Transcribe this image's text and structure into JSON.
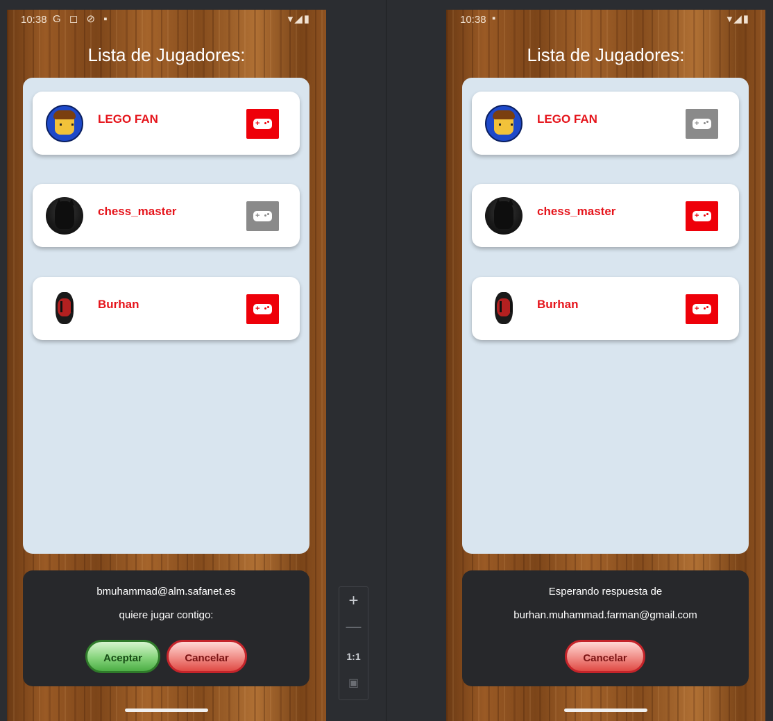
{
  "left": {
    "status_time": "10:38",
    "status_icons": "G ◻ ⊘ ▪",
    "signal_icons": "▾◢▮",
    "title": "Lista de Jugadores:",
    "players": [
      {
        "name": "LEGO FAN",
        "avatar": "lego-avatar",
        "game_button": "active"
      },
      {
        "name": "chess_master",
        "avatar": "batman-avatar",
        "game_button": "disabled"
      },
      {
        "name": "Burhan",
        "avatar": "darth-maul-avatar",
        "game_button": "active"
      }
    ],
    "dialog": {
      "line1": "bmuhammad@alm.safanet.es",
      "line2": "quiere jugar contigo:",
      "accept_label": "Aceptar",
      "cancel_label": "Cancelar"
    }
  },
  "right": {
    "status_time": "10:38",
    "status_icons": "▪",
    "signal_icons": "▾◢▮",
    "title": "Lista de Jugadores:",
    "players": [
      {
        "name": "LEGO FAN",
        "avatar": "lego-avatar",
        "game_button": "disabled"
      },
      {
        "name": "chess_master",
        "avatar": "batman-avatar",
        "game_button": "active"
      },
      {
        "name": "Burhan",
        "avatar": "darth-maul-avatar",
        "game_button": "active"
      }
    ],
    "dialog": {
      "line1": "Esperando respuesta de",
      "line2": "burhan.muhammad.farman@gmail.com",
      "cancel_label": "Cancelar"
    }
  },
  "zoom_controls": {
    "zoom_in": "+",
    "zoom_out": "—",
    "actual_size": "1:1",
    "fit_screen": "▣"
  },
  "colors": {
    "accent_red": "#ee0009",
    "disabled_gray": "#8a8a8a",
    "panel_bg": "#d9e5ef",
    "dialog_bg": "#27282b"
  }
}
